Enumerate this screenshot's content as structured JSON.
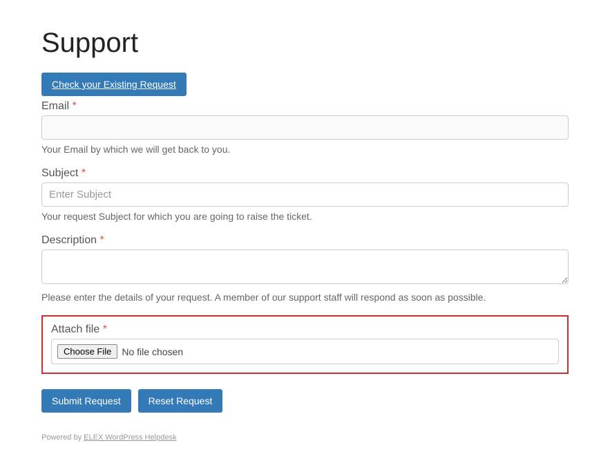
{
  "page": {
    "title": "Support"
  },
  "buttons": {
    "check_existing": "Check your Existing Request",
    "submit": "Submit Request",
    "reset": "Reset Request",
    "choose_file": "Choose File"
  },
  "fields": {
    "email": {
      "label": "Email",
      "value": "",
      "help": "Your Email by which we will get back to you."
    },
    "subject": {
      "label": "Subject",
      "placeholder": "Enter Subject",
      "help": "Your request Subject for which you are going to raise the ticket."
    },
    "description": {
      "label": "Description",
      "help": "Please enter the details of your request. A member of our support staff will respond as soon as possible."
    },
    "attach": {
      "label": "Attach file",
      "status": "No file chosen"
    }
  },
  "required_marker": "*",
  "footer": {
    "prefix": "Powered by ",
    "link_text": "ELEX WordPress Helpdesk"
  }
}
